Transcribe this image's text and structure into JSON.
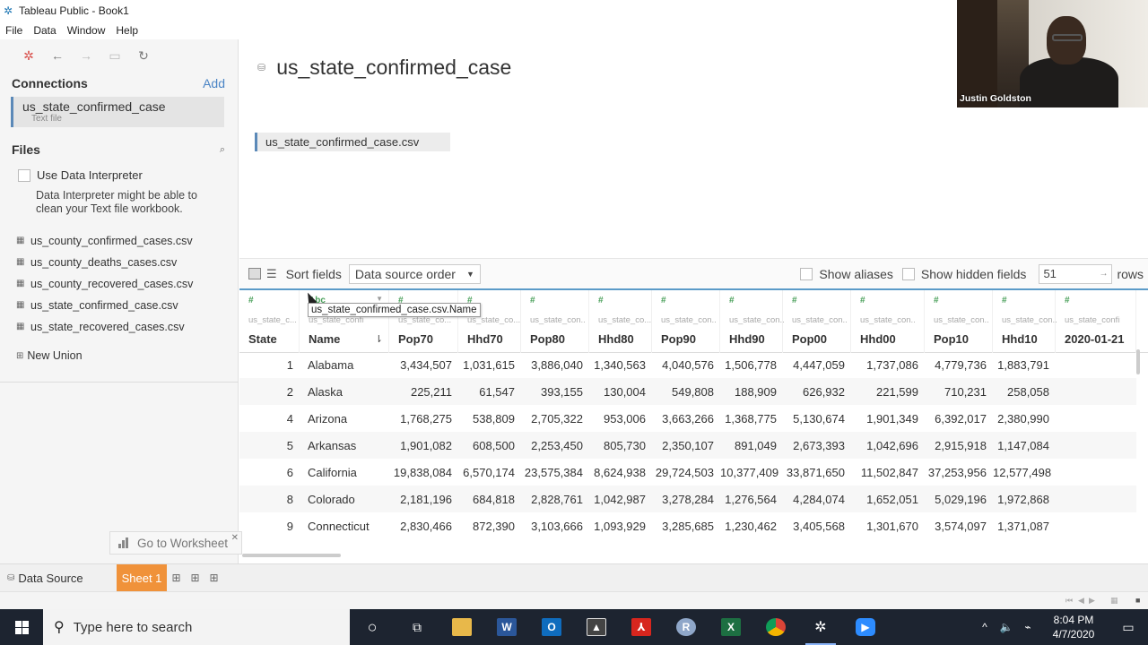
{
  "window": {
    "title": "Tableau Public - Book1"
  },
  "menu": [
    "File",
    "Data",
    "Window",
    "Help"
  ],
  "connections": {
    "heading": "Connections",
    "add_label": "Add",
    "item_name": "us_state_confirmed_case",
    "item_type": "Text file"
  },
  "files": {
    "heading": "Files",
    "interpreter_label": "Use Data Interpreter",
    "interpreter_note": "Data Interpreter might be able to clean your Text file workbook.",
    "items": [
      "us_county_confirmed_cases.csv",
      "us_county_deaths_cases.csv",
      "us_county_recovered_cases.csv",
      "us_state_confirmed_case.csv",
      "us_state_recovered_cases.csv"
    ],
    "new_union": "New Union"
  },
  "canvas": {
    "title": "us_state_confirmed_case",
    "table": "us_state_confirmed_case.csv"
  },
  "gridbar": {
    "sort_label": "Sort fields",
    "sort_value": "Data source order",
    "show_aliases": "Show aliases",
    "show_hidden": "Show hidden fields",
    "rows_value": "51",
    "rows_label": "rows"
  },
  "tooltip": "us_state_confirmed_case.csv.Name",
  "columns": [
    {
      "type": "#",
      "source": "us_state_c...",
      "name": "State"
    },
    {
      "type": "Abc",
      "source": "us_state_confirme...",
      "name": "Name"
    },
    {
      "type": "#",
      "source": "us_state_co...",
      "name": "Pop70"
    },
    {
      "type": "#",
      "source": "us_state_co...",
      "name": "Hhd70"
    },
    {
      "type": "#",
      "source": "us_state_con...",
      "name": "Pop80"
    },
    {
      "type": "#",
      "source": "us_state_co...",
      "name": "Hhd80"
    },
    {
      "type": "#",
      "source": "us_state_con...",
      "name": "Pop90"
    },
    {
      "type": "#",
      "source": "us_state_con...",
      "name": "Hhd90"
    },
    {
      "type": "#",
      "source": "us_state_con...",
      "name": "Pop00"
    },
    {
      "type": "#",
      "source": "us_state_con...",
      "name": "Hhd00"
    },
    {
      "type": "#",
      "source": "us_state_con...",
      "name": "Pop10"
    },
    {
      "type": "#",
      "source": "us_state_con...",
      "name": "Hhd10"
    },
    {
      "type": "#",
      "source": "us_state_confirme...",
      "name": "2020-01-21"
    }
  ],
  "rows": [
    [
      "1",
      "Alabama",
      "3,434,507",
      "1,031,615",
      "3,886,040",
      "1,340,563",
      "4,040,576",
      "1,506,778",
      "4,447,059",
      "1,737,086",
      "4,779,736",
      "1,883,791",
      ""
    ],
    [
      "2",
      "Alaska",
      "225,211",
      "61,547",
      "393,155",
      "130,004",
      "549,808",
      "188,909",
      "626,932",
      "221,599",
      "710,231",
      "258,058",
      ""
    ],
    [
      "4",
      "Arizona",
      "1,768,275",
      "538,809",
      "2,705,322",
      "953,006",
      "3,663,266",
      "1,368,775",
      "5,130,674",
      "1,901,349",
      "6,392,017",
      "2,380,990",
      ""
    ],
    [
      "5",
      "Arkansas",
      "1,901,082",
      "608,500",
      "2,253,450",
      "805,730",
      "2,350,107",
      "891,049",
      "2,673,393",
      "1,042,696",
      "2,915,918",
      "1,147,084",
      ""
    ],
    [
      "6",
      "California",
      "19,838,084",
      "6,570,174",
      "23,575,384",
      "8,624,938",
      "29,724,503",
      "10,377,409",
      "33,871,650",
      "11,502,847",
      "37,253,956",
      "12,577,498",
      ""
    ],
    [
      "8",
      "Colorado",
      "2,181,196",
      "684,818",
      "2,828,761",
      "1,042,987",
      "3,278,284",
      "1,276,564",
      "4,284,074",
      "1,652,051",
      "5,029,196",
      "1,972,868",
      ""
    ],
    [
      "9",
      "Connecticut",
      "2,830,466",
      "872,390",
      "3,103,666",
      "1,093,929",
      "3,285,685",
      "1,230,462",
      "3,405,568",
      "1,301,670",
      "3,574,097",
      "1,371,087",
      ""
    ]
  ],
  "goto_worksheet": "Go to Worksheet",
  "tabs": {
    "data_source": "Data Source",
    "sheet1": "Sheet 1"
  },
  "webcam_name": "Justin Goldston",
  "taskbar": {
    "search_placeholder": "Type here to search",
    "time": "8:04 PM",
    "date": "4/7/2020"
  }
}
